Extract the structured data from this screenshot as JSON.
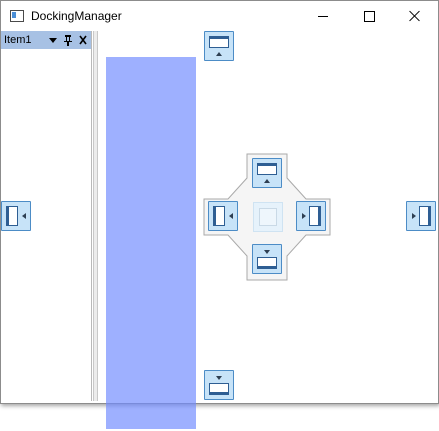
{
  "window": {
    "title": "DockingManager"
  },
  "left_pane": {
    "title": "Item1",
    "menu_glyph": "▼",
    "pin_glyph": "📌",
    "close_glyph": "✕"
  },
  "dock_guides": {
    "outer": [
      "dock-top-icon",
      "dock-bottom-icon",
      "dock-left-icon",
      "dock-right-icon"
    ],
    "inner": [
      "dock-inner-top-icon",
      "dock-inner-bottom-icon",
      "dock-inner-left-icon",
      "dock-inner-right-icon",
      "dock-center-icon"
    ]
  },
  "colors": {
    "preview": "#708aff",
    "pane_header": "#a7c1e4",
    "guide_fill": "#c7e3f8",
    "guide_border": "#4c8cc6"
  }
}
